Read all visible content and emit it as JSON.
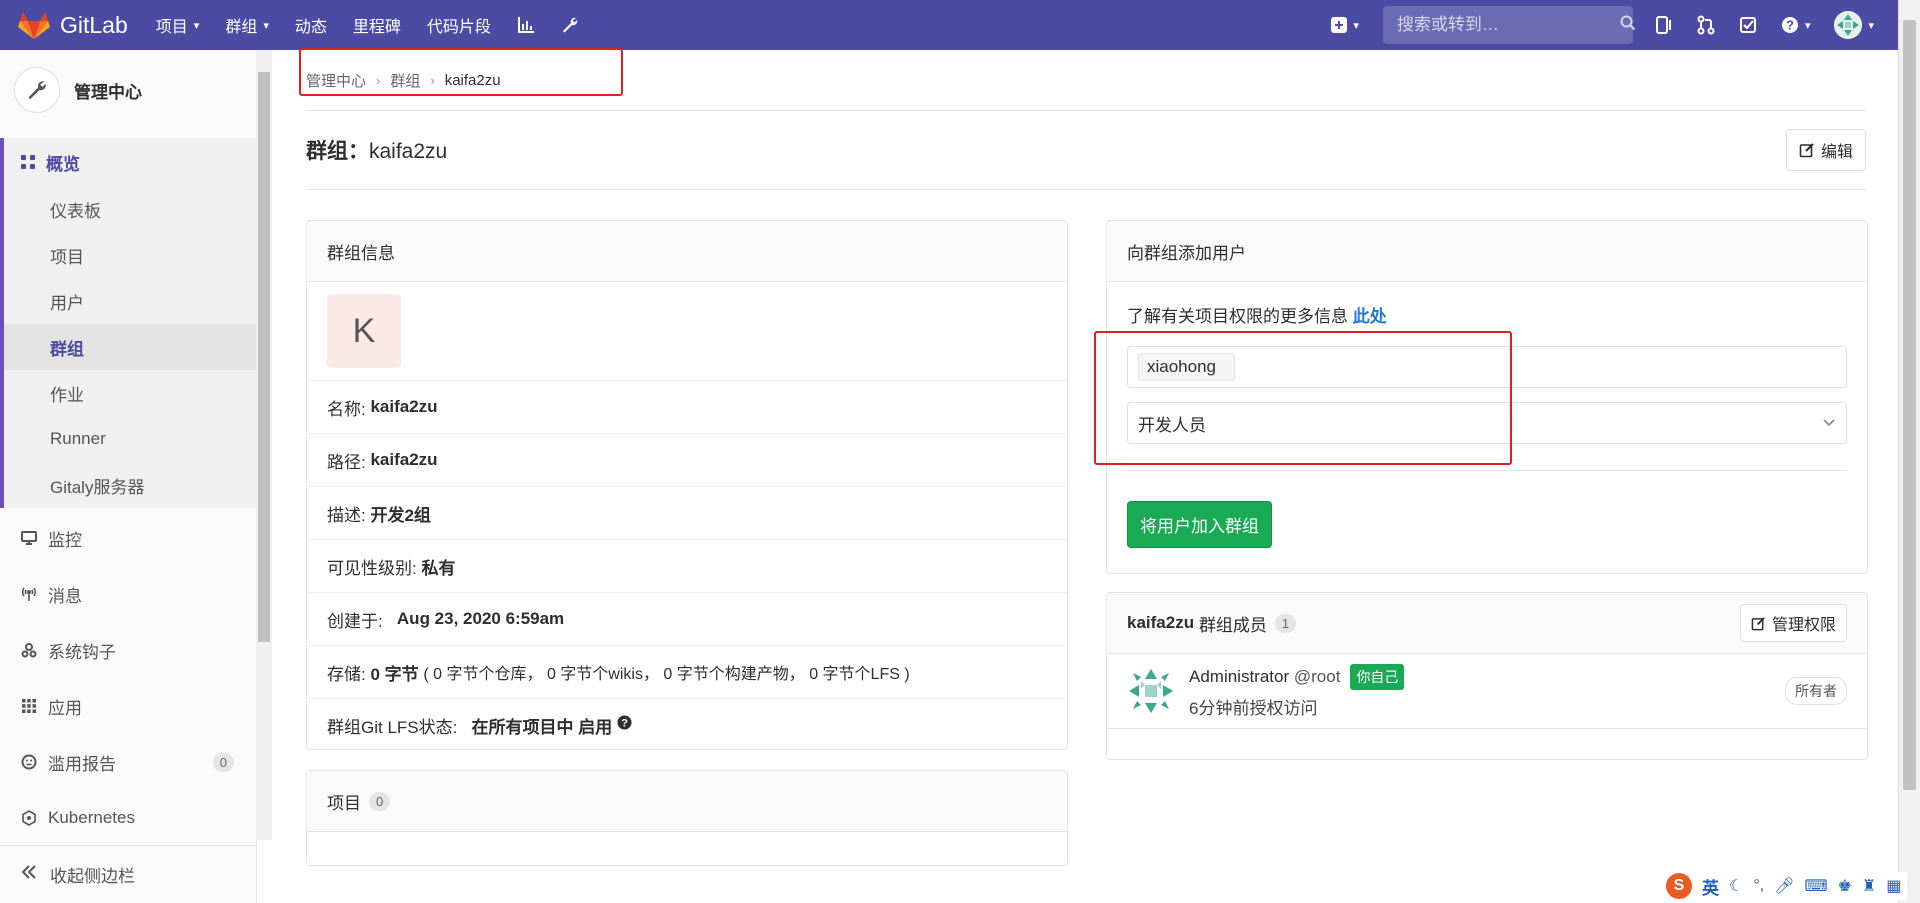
{
  "topbar": {
    "brand": "GitLab",
    "nav": [
      {
        "label": "项目",
        "caret": true
      },
      {
        "label": "群组",
        "caret": true
      },
      {
        "label": "动态",
        "caret": false
      },
      {
        "label": "里程碑",
        "caret": false
      },
      {
        "label": "代码片段",
        "caret": false
      }
    ],
    "search_placeholder": "搜索或转到…"
  },
  "sidebar": {
    "title": "管理中心",
    "overview_label": "概览",
    "sub_items": [
      "仪表板",
      "项目",
      "用户",
      "群组",
      "作业",
      "Runner",
      "Gitaly服务器"
    ],
    "active_sub": "群组",
    "items": [
      {
        "label": "监控",
        "icon": "monitor-icon"
      },
      {
        "label": "消息",
        "icon": "broadcast-icon"
      },
      {
        "label": "系统钩子",
        "icon": "hook-icon"
      },
      {
        "label": "应用",
        "icon": "apps-grid-icon"
      },
      {
        "label": "滥用报告",
        "icon": "smiley-icon",
        "badge": "0"
      },
      {
        "label": "Kubernetes",
        "icon": "kubernetes-icon"
      }
    ],
    "collapse_label": "收起侧边栏"
  },
  "breadcrumb": {
    "items": [
      "管理中心",
      "群组",
      "kaifa2zu"
    ]
  },
  "page": {
    "title_prefix": "群组：",
    "title_name": "kaifa2zu",
    "edit_label": "编辑"
  },
  "group_info": {
    "header": "群组信息",
    "avatar_letter": "K",
    "name_label": "名称:",
    "name_value": "kaifa2zu",
    "path_label": "路径:",
    "path_value": "kaifa2zu",
    "desc_label": "描述:",
    "desc_value": "开发2组",
    "visibility_label": "可见性级别:",
    "visibility_value": "私有",
    "created_label": "创建于:",
    "created_value": "Aug 23, 2020 6:59am",
    "storage_label": "存储:",
    "storage_value": "0 字节",
    "storage_detail": "( 0 字节个仓库， 0 字节个wikis， 0 字节个构建产物， 0 字节个LFS )",
    "lfs_label": "群组Git LFS状态:",
    "lfs_value": "在所有项目中 启用"
  },
  "projects": {
    "header": "项目",
    "count": "0"
  },
  "add_user": {
    "header": "向群组添加用户",
    "info_text": "了解有关项目权限的更多信息",
    "info_link": "此处",
    "user_token": "xiaohong",
    "role_value": "开发人员",
    "submit_label": "将用户加入群组"
  },
  "members": {
    "group_name": "kaifa2zu",
    "header_suffix": "群组成员",
    "count": "1",
    "manage_label": "管理权限",
    "list": [
      {
        "name": "Administrator",
        "username": "@root",
        "self_tag": "你自己",
        "access": "6分钟前授权访问",
        "role": "所有者"
      }
    ]
  },
  "ime": {
    "logo": "S",
    "lang": "英"
  }
}
